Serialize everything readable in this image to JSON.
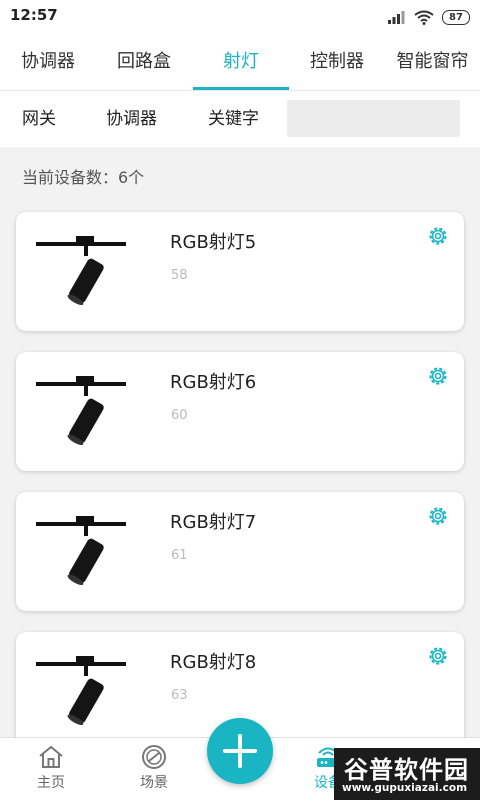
{
  "status_bar": {
    "time": "12:57",
    "battery": "87"
  },
  "tabs": [
    {
      "label": "协调器"
    },
    {
      "label": "回路盒"
    },
    {
      "label": "射灯",
      "active": true
    },
    {
      "label": "控制器"
    },
    {
      "label": "智能窗帘"
    }
  ],
  "filters": [
    {
      "label": "网关"
    },
    {
      "label": "协调器"
    },
    {
      "label": "关键字"
    }
  ],
  "search": {
    "value": "",
    "placeholder": ""
  },
  "device_count": "当前设备数：6个",
  "devices": [
    {
      "name": "RGB射灯5",
      "id": "58"
    },
    {
      "name": "RGB射灯6",
      "id": "60"
    },
    {
      "name": "RGB射灯7",
      "id": "61"
    },
    {
      "name": "RGB射灯8",
      "id": "63"
    }
  ],
  "bottom_nav": [
    {
      "label": "主页",
      "icon": "home-icon"
    },
    {
      "label": "场景",
      "icon": "scene-icon"
    },
    {
      "label": "设备",
      "icon": "device-icon",
      "active": true
    }
  ],
  "watermark": {
    "logo": "谷普软件园",
    "url": "www.gupuxiazai.com"
  },
  "colors": {
    "accent": "#1ab5c3"
  }
}
